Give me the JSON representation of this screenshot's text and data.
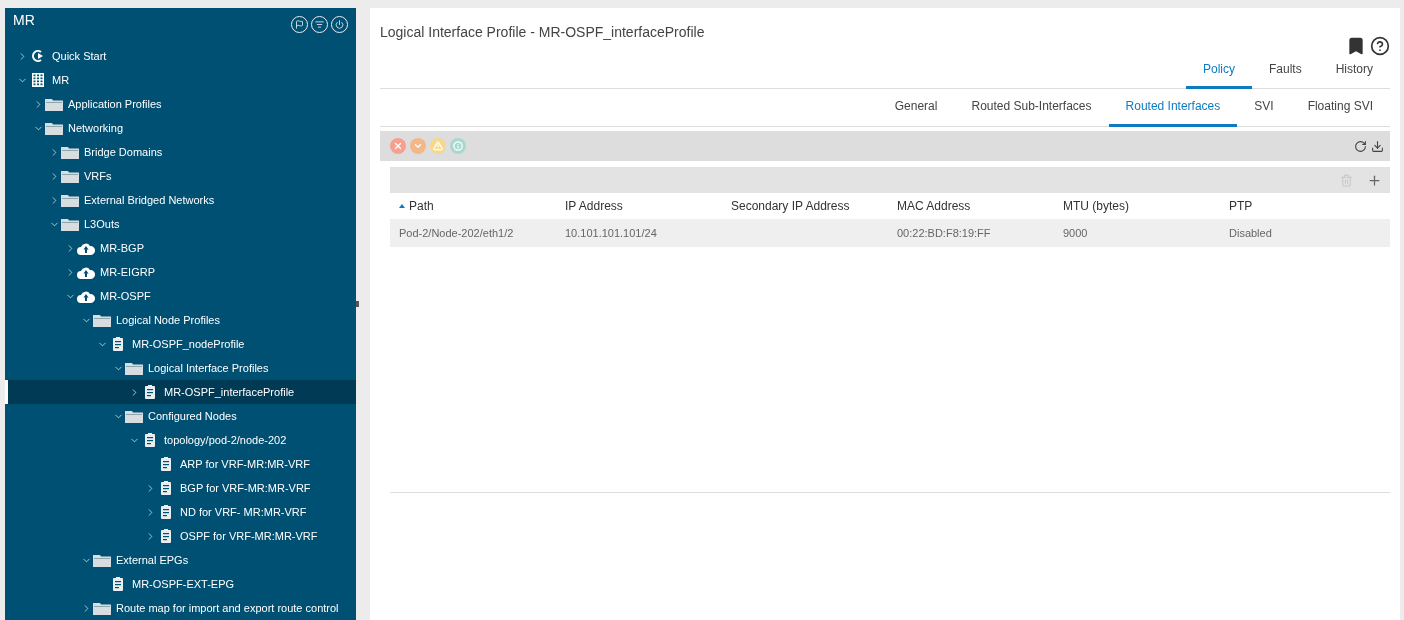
{
  "sidebar": {
    "title": "MR",
    "tree": [
      {
        "label": "Quick Start",
        "kind": "quickstart",
        "expanded": false,
        "selected": false
      },
      {
        "label": "MR",
        "kind": "tenant",
        "expanded": true,
        "selected": false,
        "children": [
          {
            "label": "Application Profiles",
            "kind": "folder",
            "expanded": false,
            "selected": false
          },
          {
            "label": "Networking",
            "kind": "folder",
            "expanded": true,
            "selected": false,
            "children": [
              {
                "label": "Bridge Domains",
                "kind": "folder",
                "expanded": false,
                "selected": false
              },
              {
                "label": "VRFs",
                "kind": "folder",
                "expanded": false,
                "selected": false
              },
              {
                "label": "External Bridged Networks",
                "kind": "folder",
                "expanded": false,
                "selected": false
              },
              {
                "label": "L3Outs",
                "kind": "folder",
                "expanded": true,
                "selected": false,
                "children": [
                  {
                    "label": "MR-BGP",
                    "kind": "cloud",
                    "expanded": false,
                    "selected": false
                  },
                  {
                    "label": "MR-EIGRP",
                    "kind": "cloud",
                    "expanded": false,
                    "selected": false
                  },
                  {
                    "label": "MR-OSPF",
                    "kind": "cloud",
                    "expanded": true,
                    "selected": false,
                    "children": [
                      {
                        "label": "Logical Node Profiles",
                        "kind": "folder",
                        "expanded": true,
                        "selected": false,
                        "children": [
                          {
                            "label": "MR-OSPF_nodeProfile",
                            "kind": "doc",
                            "expanded": true,
                            "selected": false,
                            "children": [
                              {
                                "label": "Logical Interface Profiles",
                                "kind": "folder",
                                "expanded": true,
                                "selected": false,
                                "children": [
                                  {
                                    "label": "MR-OSPF_interfaceProfile",
                                    "kind": "doc",
                                    "expanded": false,
                                    "selected": true
                                  }
                                ]
                              },
                              {
                                "label": "Configured Nodes",
                                "kind": "folder",
                                "expanded": true,
                                "selected": false,
                                "children": [
                                  {
                                    "label": "topology/pod-2/node-202",
                                    "kind": "doc",
                                    "expanded": true,
                                    "selected": false,
                                    "children": [
                                      {
                                        "label": "ARP for VRF-MR:MR-VRF",
                                        "kind": "doc",
                                        "selected": false
                                      },
                                      {
                                        "label": "BGP for VRF-MR:MR-VRF",
                                        "kind": "doc",
                                        "expanded": false,
                                        "selected": false
                                      },
                                      {
                                        "label": "ND for VRF- MR:MR-VRF",
                                        "kind": "doc",
                                        "expanded": false,
                                        "selected": false
                                      },
                                      {
                                        "label": "OSPF for VRF-MR:MR-VRF",
                                        "kind": "doc",
                                        "expanded": false,
                                        "selected": false
                                      }
                                    ]
                                  }
                                ]
                              }
                            ]
                          }
                        ]
                      },
                      {
                        "label": "External EPGs",
                        "kind": "folder",
                        "expanded": true,
                        "selected": false,
                        "children": [
                          {
                            "label": "MR-OSPF-EXT-EPG",
                            "kind": "doc",
                            "selected": false
                          }
                        ]
                      },
                      {
                        "label": "Route map for import and export route control",
                        "kind": "folder",
                        "expanded": false,
                        "selected": false
                      }
                    ]
                  }
                ]
              }
            ]
          }
        ]
      }
    ]
  },
  "main": {
    "title": "Logical Interface Profile - MR-OSPF_interfaceProfile",
    "tabs": [
      {
        "label": "Policy",
        "selected": true
      },
      {
        "label": "Faults",
        "selected": false
      },
      {
        "label": "History",
        "selected": false
      }
    ],
    "subtabs": [
      {
        "label": "General",
        "selected": false
      },
      {
        "label": "Routed Sub-Interfaces",
        "selected": false
      },
      {
        "label": "Routed Interfaces",
        "selected": true
      },
      {
        "label": "SVI",
        "selected": false
      },
      {
        "label": "Floating SVI",
        "selected": false
      }
    ],
    "faults": [
      {
        "kind": "critical",
        "color": "#f4a18f"
      },
      {
        "kind": "major",
        "color": "#f3b88a"
      },
      {
        "kind": "minor",
        "color": "#f5d88c"
      },
      {
        "kind": "warning",
        "color": "#a9d8d0"
      }
    ],
    "table": {
      "columns": [
        {
          "label": "Path",
          "sorted": true
        },
        {
          "label": "IP Address",
          "sorted": false
        },
        {
          "label": "Secondary IP Address",
          "sorted": false
        },
        {
          "label": "MAC Address",
          "sorted": false
        },
        {
          "label": "MTU (bytes)",
          "sorted": false
        },
        {
          "label": "PTP",
          "sorted": false
        }
      ],
      "rows": [
        [
          "Pod-2/Node-202/eth1/2",
          "10.101.101.101/24",
          "",
          "00:22:BD:F8:19:FF",
          "9000",
          "Disabled"
        ]
      ]
    }
  }
}
